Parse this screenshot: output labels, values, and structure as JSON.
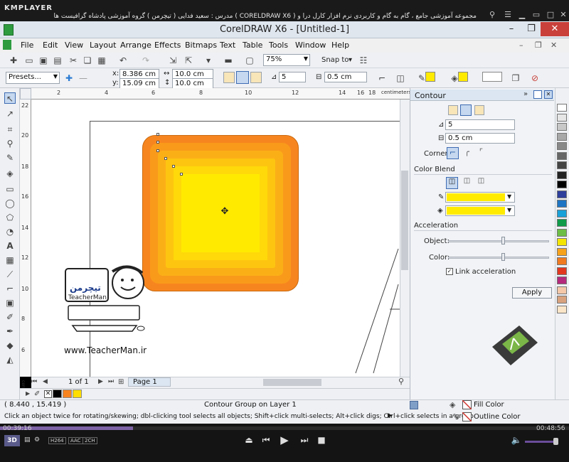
{
  "player": {
    "logo": "KMPLAYER",
    "caption": "مجموعه آموزشی جامع ، گام به گام و کاربردی نرم افزار کارل درا و ( CORELDRAW X6 )  مدرس : سعید فدایی ( تیچرمن ) گروه آموزشی پادشاه گرافیست ها",
    "time_elapsed": "00:39:16",
    "time_total": "00:48:56",
    "progress_fraction": 0.234,
    "badges": [
      "H264",
      "AAC",
      "2CH"
    ],
    "mode_3d": "3D"
  },
  "window": {
    "title": "CorelDRAW X6 - [Untitled-1]"
  },
  "menu": [
    "File",
    "Edit",
    "View",
    "Layout",
    "Arrange",
    "Effects",
    "Bitmaps",
    "Text",
    "Table",
    "Tools",
    "Window",
    "Help"
  ],
  "toolbar": {
    "zoom_value": "75%",
    "snap_label": "Snap to",
    "presets_value": "Presets...",
    "x_label": "x:",
    "x_value": "8.386 cm",
    "y_label": "y:",
    "y_value": "15.09 cm",
    "width_value": "10.0 cm",
    "height_value": "10.0 cm",
    "steps_value": "5",
    "offset_value": "0.5 cm"
  },
  "ruler": {
    "units": "centimeters",
    "h_ticks": [
      "2",
      "4",
      "6",
      "8",
      "10",
      "12",
      "14",
      "16",
      "18"
    ],
    "v_ticks": [
      "22",
      "20",
      "18",
      "16",
      "14",
      "12",
      "10",
      "8",
      "6"
    ]
  },
  "docker": {
    "title": "Contour",
    "steps_value": "5",
    "offset_value": "0.5 cm",
    "corner_label": "Corner:",
    "color_blend_label": "Color Blend",
    "acceleration_label": "Acceleration",
    "object_label": "Object:",
    "color_label": "Color:",
    "link_accel_label": "Link acceleration",
    "link_accel_checked": true,
    "object_accel": 0.55,
    "color_accel": 0.55,
    "apply_label": "Apply",
    "outline_color": "#ffeb00",
    "fill_color": "#ffeb00"
  },
  "pages": {
    "counter": "1 of 1",
    "tab": "Page 1"
  },
  "document_palette": [
    "#000000",
    "#f7831f",
    "#ffde00"
  ],
  "status": {
    "coords": "( 8.440 , 15.419 )",
    "selection": "Contour Group on Layer 1",
    "hint": "Click an object twice for rotating/skewing; dbl-clicking tool selects all objects; Shift+click multi-selects; Alt+click digs; Ctrl+click selects in a group",
    "fill_label": "Fill Color",
    "outline_label": "Outline Color"
  },
  "watermark": {
    "url": "www.TeacherMan.ir",
    "brand": "TeacherMan",
    "brand_fa": "تیچرمن"
  },
  "palette_colors": [
    "#ffffff",
    "#e6e6e6",
    "#c8c8c8",
    "#a8a8a8",
    "#888888",
    "#666666",
    "#444444",
    "#222222",
    "#000000",
    "#2d3e9b",
    "#1d74c2",
    "#18a0d8",
    "#0f9b4a",
    "#6cbd45",
    "#f4e500",
    "#f7a21b",
    "#f07a20",
    "#e2371f",
    "#b52a7c",
    "#f4c8a8",
    "#d8a27e",
    "#fbe5c8"
  ],
  "contour": {
    "colors": [
      "#f7851f",
      "#f99a1b",
      "#fbaf17",
      "#fdc510",
      "#ffd90a",
      "#ffea00"
    ]
  }
}
